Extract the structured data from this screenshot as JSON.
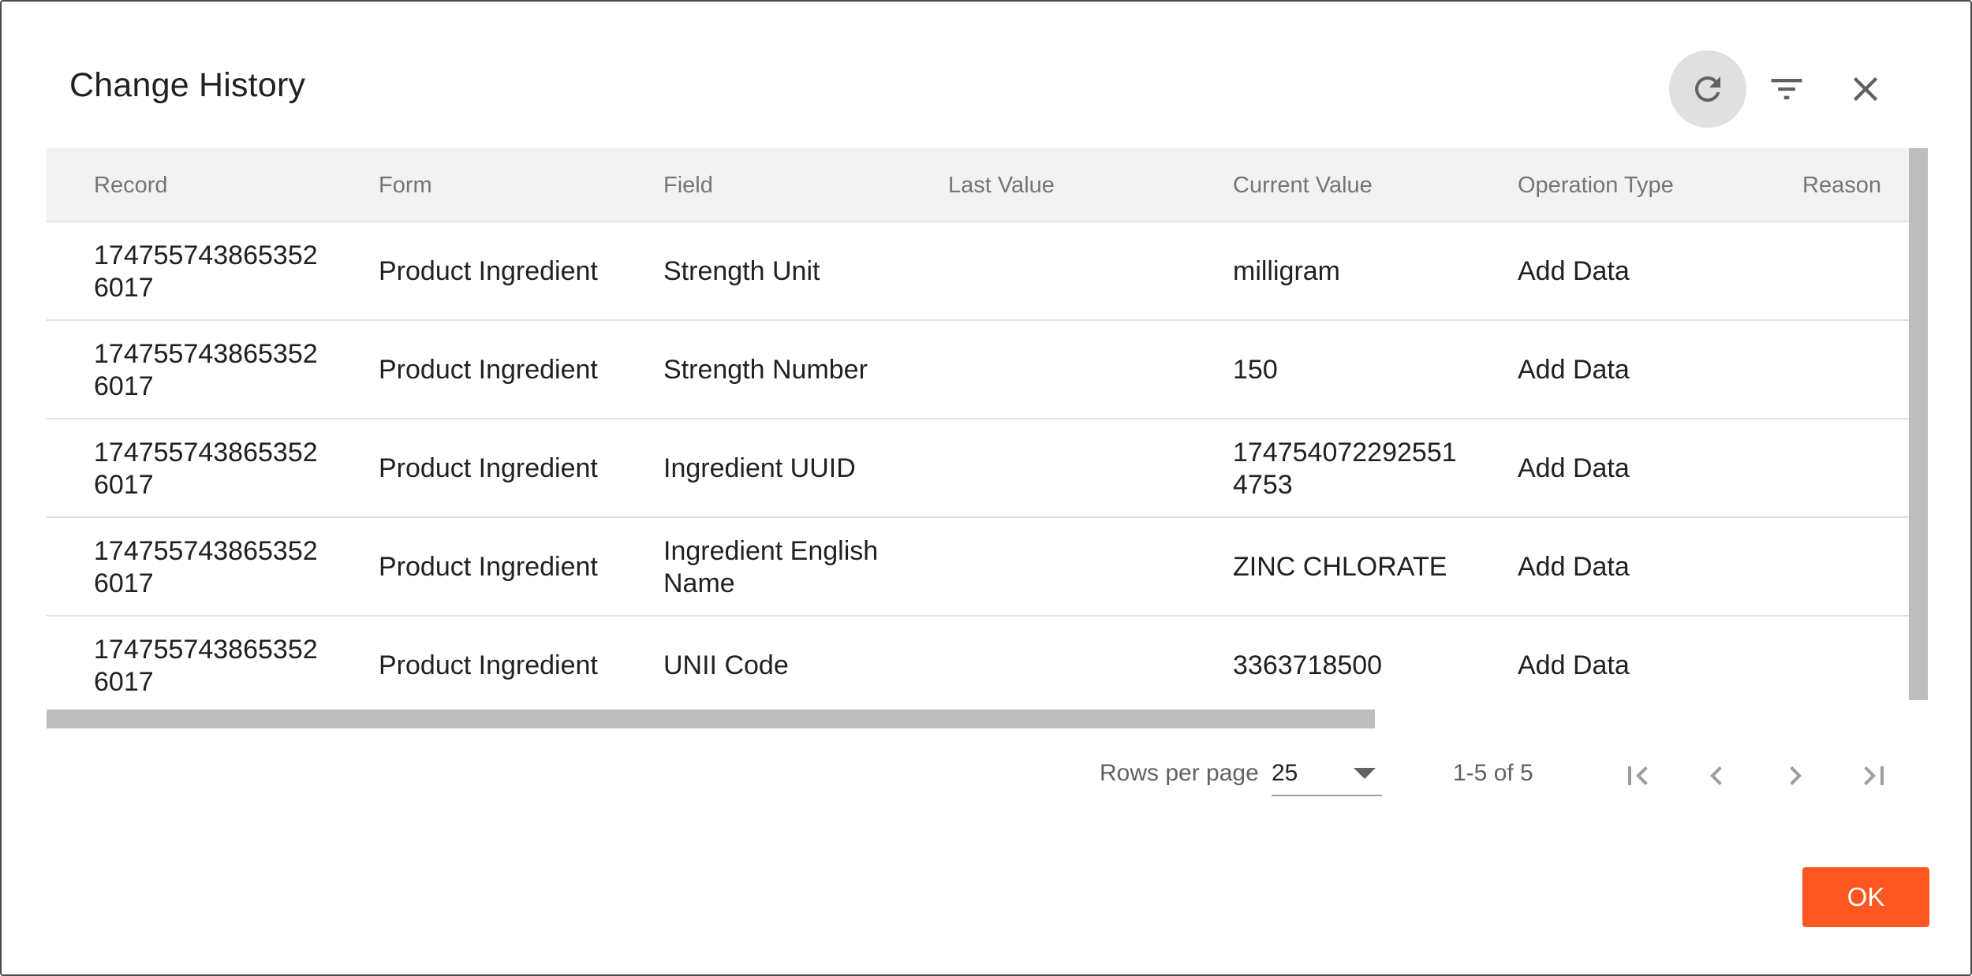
{
  "dialog": {
    "title": "Change History"
  },
  "toolbar": {
    "refresh_icon": "refresh-icon",
    "filter_icon": "filter-icon",
    "close_icon": "close-icon"
  },
  "table": {
    "columns": [
      "Record",
      "Form",
      "Field",
      "Last Value",
      "Current Value",
      "Operation Type",
      "Reason"
    ],
    "rows": [
      {
        "record": "1747557438653526017",
        "form": "Product Ingredient",
        "field": "Strength Unit",
        "last_value": "",
        "current_value": "milligram",
        "operation_type": "Add Data",
        "reason": ""
      },
      {
        "record": "1747557438653526017",
        "form": "Product Ingredient",
        "field": "Strength Number",
        "last_value": "",
        "current_value": "150",
        "operation_type": "Add Data",
        "reason": ""
      },
      {
        "record": "1747557438653526017",
        "form": "Product Ingredient",
        "field": "Ingredient UUID",
        "last_value": "",
        "current_value": "1747540722925514753",
        "operation_type": "Add Data",
        "reason": ""
      },
      {
        "record": "1747557438653526017",
        "form": "Product Ingredient",
        "field": "Ingredient English Name",
        "last_value": "",
        "current_value": "ZINC CHLORATE",
        "operation_type": "Add Data",
        "reason": ""
      },
      {
        "record": "1747557438653526017",
        "form": "Product Ingredient",
        "field": "UNII Code",
        "last_value": "",
        "current_value": "3363718500",
        "operation_type": "Add Data",
        "reason": ""
      }
    ]
  },
  "pagination": {
    "rows_per_page_label": "Rows per page",
    "rows_per_page_value": "25",
    "range_label": "1-5 of 5"
  },
  "footer": {
    "ok_label": "OK"
  },
  "colors": {
    "accent": "#ff5722",
    "header_bg": "#f2f2f2",
    "scrollbar": "#bdbdbd"
  }
}
